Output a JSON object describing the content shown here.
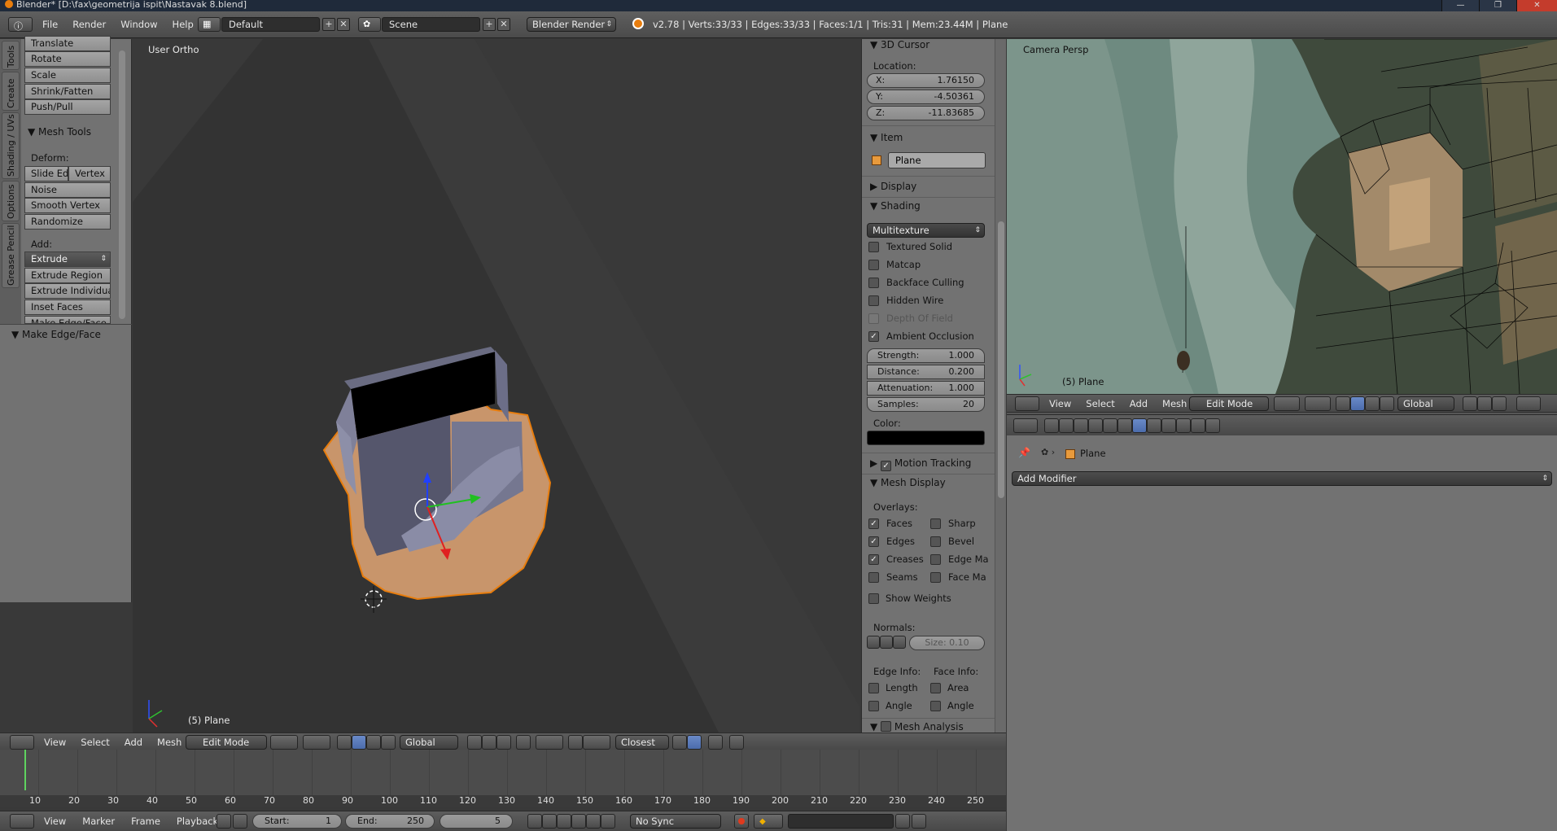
{
  "window": {
    "title": "Blender* [D:\\fax\\geometrija ispit\\Nastavak 8.blend]",
    "controls": [
      "—",
      "❐",
      "✕"
    ]
  },
  "topbar": {
    "menus": [
      "File",
      "Render",
      "Window",
      "Help"
    ],
    "layout": "Default",
    "scene": "Scene",
    "engine": "Blender Render",
    "stats": "v2.78 | Verts:33/33 | Edges:33/33 | Faces:1/1 | Tris:31 | Mem:23.44M | Plane"
  },
  "tool_tabs": [
    "Tools",
    "Create",
    "Shading / UVs",
    "Options",
    "Grease Pencil"
  ],
  "toolshelf": {
    "transform_buttons": [
      "Translate",
      "Rotate",
      "Scale",
      "Shrink/Fatten",
      "Push/Pull"
    ],
    "mesh_tools_title": "Mesh Tools",
    "deform_label": "Deform:",
    "deform_row": [
      "Slide Ed",
      "Vertex"
    ],
    "deform_buttons": [
      "Noise",
      "Smooth Vertex",
      "Randomize"
    ],
    "add_label": "Add:",
    "extrude_dropdown": "Extrude",
    "add_buttons": [
      "Extrude Region",
      "Extrude Individual",
      "Inset Faces",
      "Make Edge/Face"
    ],
    "operator_panel": "Make Edge/Face"
  },
  "viewport": {
    "view_name": "User Ortho",
    "object_label": "(5) Plane",
    "header_menus": [
      "View",
      "Select",
      "Add",
      "Mesh"
    ],
    "mode": "Edit Mode",
    "orientation": "Global",
    "snap": "Closest"
  },
  "properties": {
    "cursor_title": "3D Cursor",
    "location_label": "Location:",
    "cursor": [
      {
        "label": "X:",
        "value": "1.76150"
      },
      {
        "label": "Y:",
        "value": "-4.50361"
      },
      {
        "label": "Z:",
        "value": "-11.83685"
      }
    ],
    "item_title": "Item",
    "item_name": "Plane",
    "display_title": "Display",
    "shading_title": "Shading",
    "shading_mode": "Multitexture",
    "shading_checks": [
      {
        "label": "Textured Solid",
        "checked": false,
        "disabled": false
      },
      {
        "label": "Matcap",
        "checked": false,
        "disabled": false
      },
      {
        "label": "Backface Culling",
        "checked": false,
        "disabled": false
      },
      {
        "label": "Hidden Wire",
        "checked": false,
        "disabled": false
      },
      {
        "label": "Depth Of Field",
        "checked": false,
        "disabled": true
      },
      {
        "label": "Ambient Occlusion",
        "checked": true,
        "disabled": false
      }
    ],
    "ao_fields": [
      {
        "label": "Strength:",
        "value": "1.000"
      },
      {
        "label": "Distance:",
        "value": "0.200"
      },
      {
        "label": "Attenuation:",
        "value": "1.000"
      },
      {
        "label": "Samples:",
        "value": "20"
      }
    ],
    "color_label": "Color:",
    "motion_tracking_title": "Motion Tracking",
    "mesh_display_title": "Mesh Display",
    "overlays_label": "Overlays:",
    "overlays_left": [
      {
        "label": "Faces",
        "checked": true
      },
      {
        "label": "Edges",
        "checked": true
      },
      {
        "label": "Creases",
        "checked": true
      },
      {
        "label": "Seams",
        "checked": false
      }
    ],
    "overlays_right": [
      {
        "label": "Sharp",
        "checked": false
      },
      {
        "label": "Bevel",
        "checked": false
      },
      {
        "label": "Edge Ma",
        "checked": false
      },
      {
        "label": "Face Ma",
        "checked": false
      }
    ],
    "show_weights": "Show Weights",
    "normals_label": "Normals:",
    "normals_size": "Size:  0.10",
    "edge_info_label": "Edge Info:",
    "face_info_label": "Face Info:",
    "edge_info": [
      "Length",
      "Angle"
    ],
    "face_info": [
      "Area",
      "Angle"
    ],
    "mesh_analysis_title": "Mesh Analysis"
  },
  "camera_view": {
    "view_name": "Camera Persp",
    "object_label": "(5) Plane",
    "header_menus": [
      "View",
      "Select",
      "Add",
      "Mesh"
    ],
    "mode": "Edit Mode",
    "orientation": "Global"
  },
  "modifiers": {
    "object": "Plane",
    "add_modifier": "Add Modifier"
  },
  "timeline": {
    "ticks": [
      "10",
      "20",
      "30",
      "40",
      "50",
      "60",
      "70",
      "80",
      "90",
      "100",
      "110",
      "120",
      "130",
      "140",
      "150",
      "160",
      "170",
      "180",
      "190",
      "200",
      "210",
      "220",
      "230",
      "240",
      "250"
    ],
    "current_frame_value": 5,
    "menus": [
      "View",
      "Marker",
      "Frame",
      "Playback"
    ],
    "start": "Start:",
    "start_value": "1",
    "end": "End:",
    "end_value": "250",
    "current": "5",
    "sync": "No Sync"
  },
  "colors": {
    "accent_orange": "#e87d0d",
    "panel": "#727272",
    "viewport": "#393939",
    "selected_face": "#c8956b"
  }
}
